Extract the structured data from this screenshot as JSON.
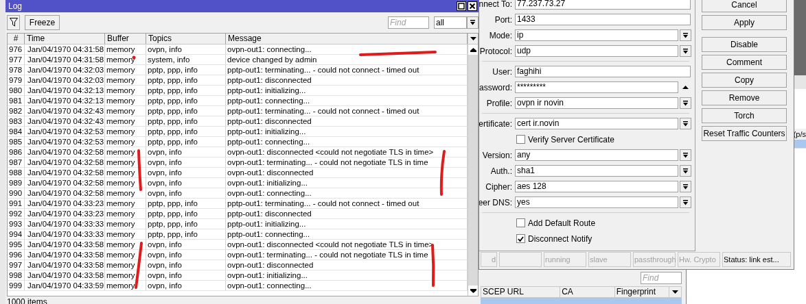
{
  "log_window": {
    "title": "Log",
    "freeze_button": "Freeze",
    "find_placeholder": "Find",
    "filter_value": "all",
    "columns": [
      "#",
      "Time",
      "Buffer",
      "Topics",
      "Message"
    ],
    "rows": [
      [
        "976",
        "Jan/04/1970 04:31:58",
        "memory",
        "ovpn, info",
        "ovpn-out1: connecting..."
      ],
      [
        "977",
        "Jan/04/1970 04:31:58",
        "memory",
        "system, info",
        "device changed by admin"
      ],
      [
        "978",
        "Jan/04/1970 04:32:03",
        "memory",
        "pptp, ppp, info",
        "pptp-out1: terminating... - could not connect - timed out"
      ],
      [
        "979",
        "Jan/04/1970 04:32:03",
        "memory",
        "pptp, ppp, info",
        "pptp-out1: disconnected"
      ],
      [
        "980",
        "Jan/04/1970 04:32:13",
        "memory",
        "pptp, ppp, info",
        "pptp-out1: initializing..."
      ],
      [
        "981",
        "Jan/04/1970 04:32:13",
        "memory",
        "pptp, ppp, info",
        "pptp-out1: connecting..."
      ],
      [
        "982",
        "Jan/04/1970 04:32:43",
        "memory",
        "pptp, ppp, info",
        "pptp-out1: terminating... - could not connect - timed out"
      ],
      [
        "983",
        "Jan/04/1970 04:32:43",
        "memory",
        "pptp, ppp, info",
        "pptp-out1: disconnected"
      ],
      [
        "984",
        "Jan/04/1970 04:32:53",
        "memory",
        "pptp, ppp, info",
        "pptp-out1: initializing..."
      ],
      [
        "985",
        "Jan/04/1970 04:32:53",
        "memory",
        "pptp, ppp, info",
        "pptp-out1: connecting..."
      ],
      [
        "986",
        "Jan/04/1970 04:32:58",
        "memory",
        "ovpn, info",
        "ovpn-out1: disconnected <could not negotiate TLS in time>"
      ],
      [
        "987",
        "Jan/04/1970 04:32:58",
        "memory",
        "ovpn, info",
        "ovpn-out1: terminating... - could not negotiate TLS in time"
      ],
      [
        "988",
        "Jan/04/1970 04:32:58",
        "memory",
        "ovpn, info",
        "ovpn-out1: disconnected"
      ],
      [
        "989",
        "Jan/04/1970 04:32:58",
        "memory",
        "ovpn, info",
        "ovpn-out1: initializing..."
      ],
      [
        "990",
        "Jan/04/1970 04:32:58",
        "memory",
        "ovpn, info",
        "ovpn-out1: connecting..."
      ],
      [
        "991",
        "Jan/04/1970 04:33:23",
        "memory",
        "pptp, ppp, info",
        "pptp-out1: terminating... - could not connect - timed out"
      ],
      [
        "992",
        "Jan/04/1970 04:33:23",
        "memory",
        "pptp, ppp, info",
        "pptp-out1: disconnected"
      ],
      [
        "993",
        "Jan/04/1970 04:33:33",
        "memory",
        "pptp, ppp, info",
        "pptp-out1: initializing..."
      ],
      [
        "994",
        "Jan/04/1970 04:33:33",
        "memory",
        "pptp, ppp, info",
        "pptp-out1: connecting..."
      ],
      [
        "995",
        "Jan/04/1970 04:33:58",
        "memory",
        "ovpn, info",
        "ovpn-out1: disconnected <could not negotiate TLS in time>"
      ],
      [
        "996",
        "Jan/04/1970 04:33:58",
        "memory",
        "ovpn, info",
        "ovpn-out1: terminating... - could not negotiate TLS in time"
      ],
      [
        "997",
        "Jan/04/1970 04:33:58",
        "memory",
        "ovpn, info",
        "ovpn-out1: disconnected"
      ],
      [
        "998",
        "Jan/04/1970 04:33:58",
        "memory",
        "ovpn, info",
        "ovpn-out1: initializing..."
      ],
      [
        "999",
        "Jan/04/1970 04:33:59",
        "memory",
        "ovpn, info",
        "ovpn-out1: connecting..."
      ]
    ],
    "status": "1000 items"
  },
  "interface_dialog": {
    "form": [
      {
        "kind": "text",
        "label": "nnect To:",
        "value": "77.237.73.27"
      },
      {
        "kind": "text",
        "label": "Port:",
        "value": "1433"
      },
      {
        "kind": "dropdown",
        "label": "Mode:",
        "value": "ip"
      },
      {
        "kind": "dropdown",
        "label": "Protocol:",
        "value": "udp"
      },
      {
        "kind": "separator"
      },
      {
        "kind": "text",
        "label": "User:",
        "value": "faghihi"
      },
      {
        "kind": "password",
        "label": "assword:",
        "value": "*********"
      },
      {
        "kind": "dropdown",
        "label": "Profile:",
        "value": "ovpn ir novin"
      },
      {
        "kind": "separator"
      },
      {
        "kind": "dropdown",
        "label": "ertificate:",
        "value": "cert ir.novin"
      },
      {
        "kind": "checkbox",
        "label": "Verify Server Certificate",
        "checked": false
      },
      {
        "kind": "dropdown",
        "label": "Version:",
        "value": "any"
      },
      {
        "kind": "dropdown",
        "label": "Auth.:",
        "value": "sha1"
      },
      {
        "kind": "dropdown",
        "label": "Cipher:",
        "value": "aes 128"
      },
      {
        "kind": "dropdown",
        "label": "eer DNS:",
        "value": "yes"
      },
      {
        "kind": "separator"
      },
      {
        "kind": "checkbox",
        "label": "Add Default Route",
        "checked": false
      },
      {
        "kind": "checkbox",
        "label": "Disconnect Notify",
        "checked": true
      }
    ],
    "button_groups": [
      [
        "Cancel",
        "Apply"
      ],
      [
        "Disable",
        "Comment",
        "Copy",
        "Remove",
        "Torch",
        "Reset Traffic Counters"
      ]
    ],
    "status_cells": [
      {
        "kind": "text",
        "text": "d",
        "disabled": true
      },
      {
        "kind": "blank"
      },
      {
        "kind": "text",
        "text": "running",
        "disabled": true
      },
      {
        "kind": "text",
        "text": "slave",
        "disabled": true
      },
      {
        "kind": "text",
        "text": "passthrough",
        "disabled": true
      },
      {
        "kind": "text",
        "text": "Hw. Crypto",
        "disabled": true
      },
      {
        "kind": "text",
        "text": "Status: link est...",
        "disabled": false
      }
    ]
  },
  "certificates_window": {
    "find_placeholder": "Find",
    "columns": [
      "SCEP URL",
      "CA",
      "Fingerprint"
    ],
    "rows": [
      {
        "selected": true
      }
    ]
  },
  "background_window": {
    "column_header": "(p/s",
    "rows": [
      {
        "selected": true
      }
    ]
  }
}
